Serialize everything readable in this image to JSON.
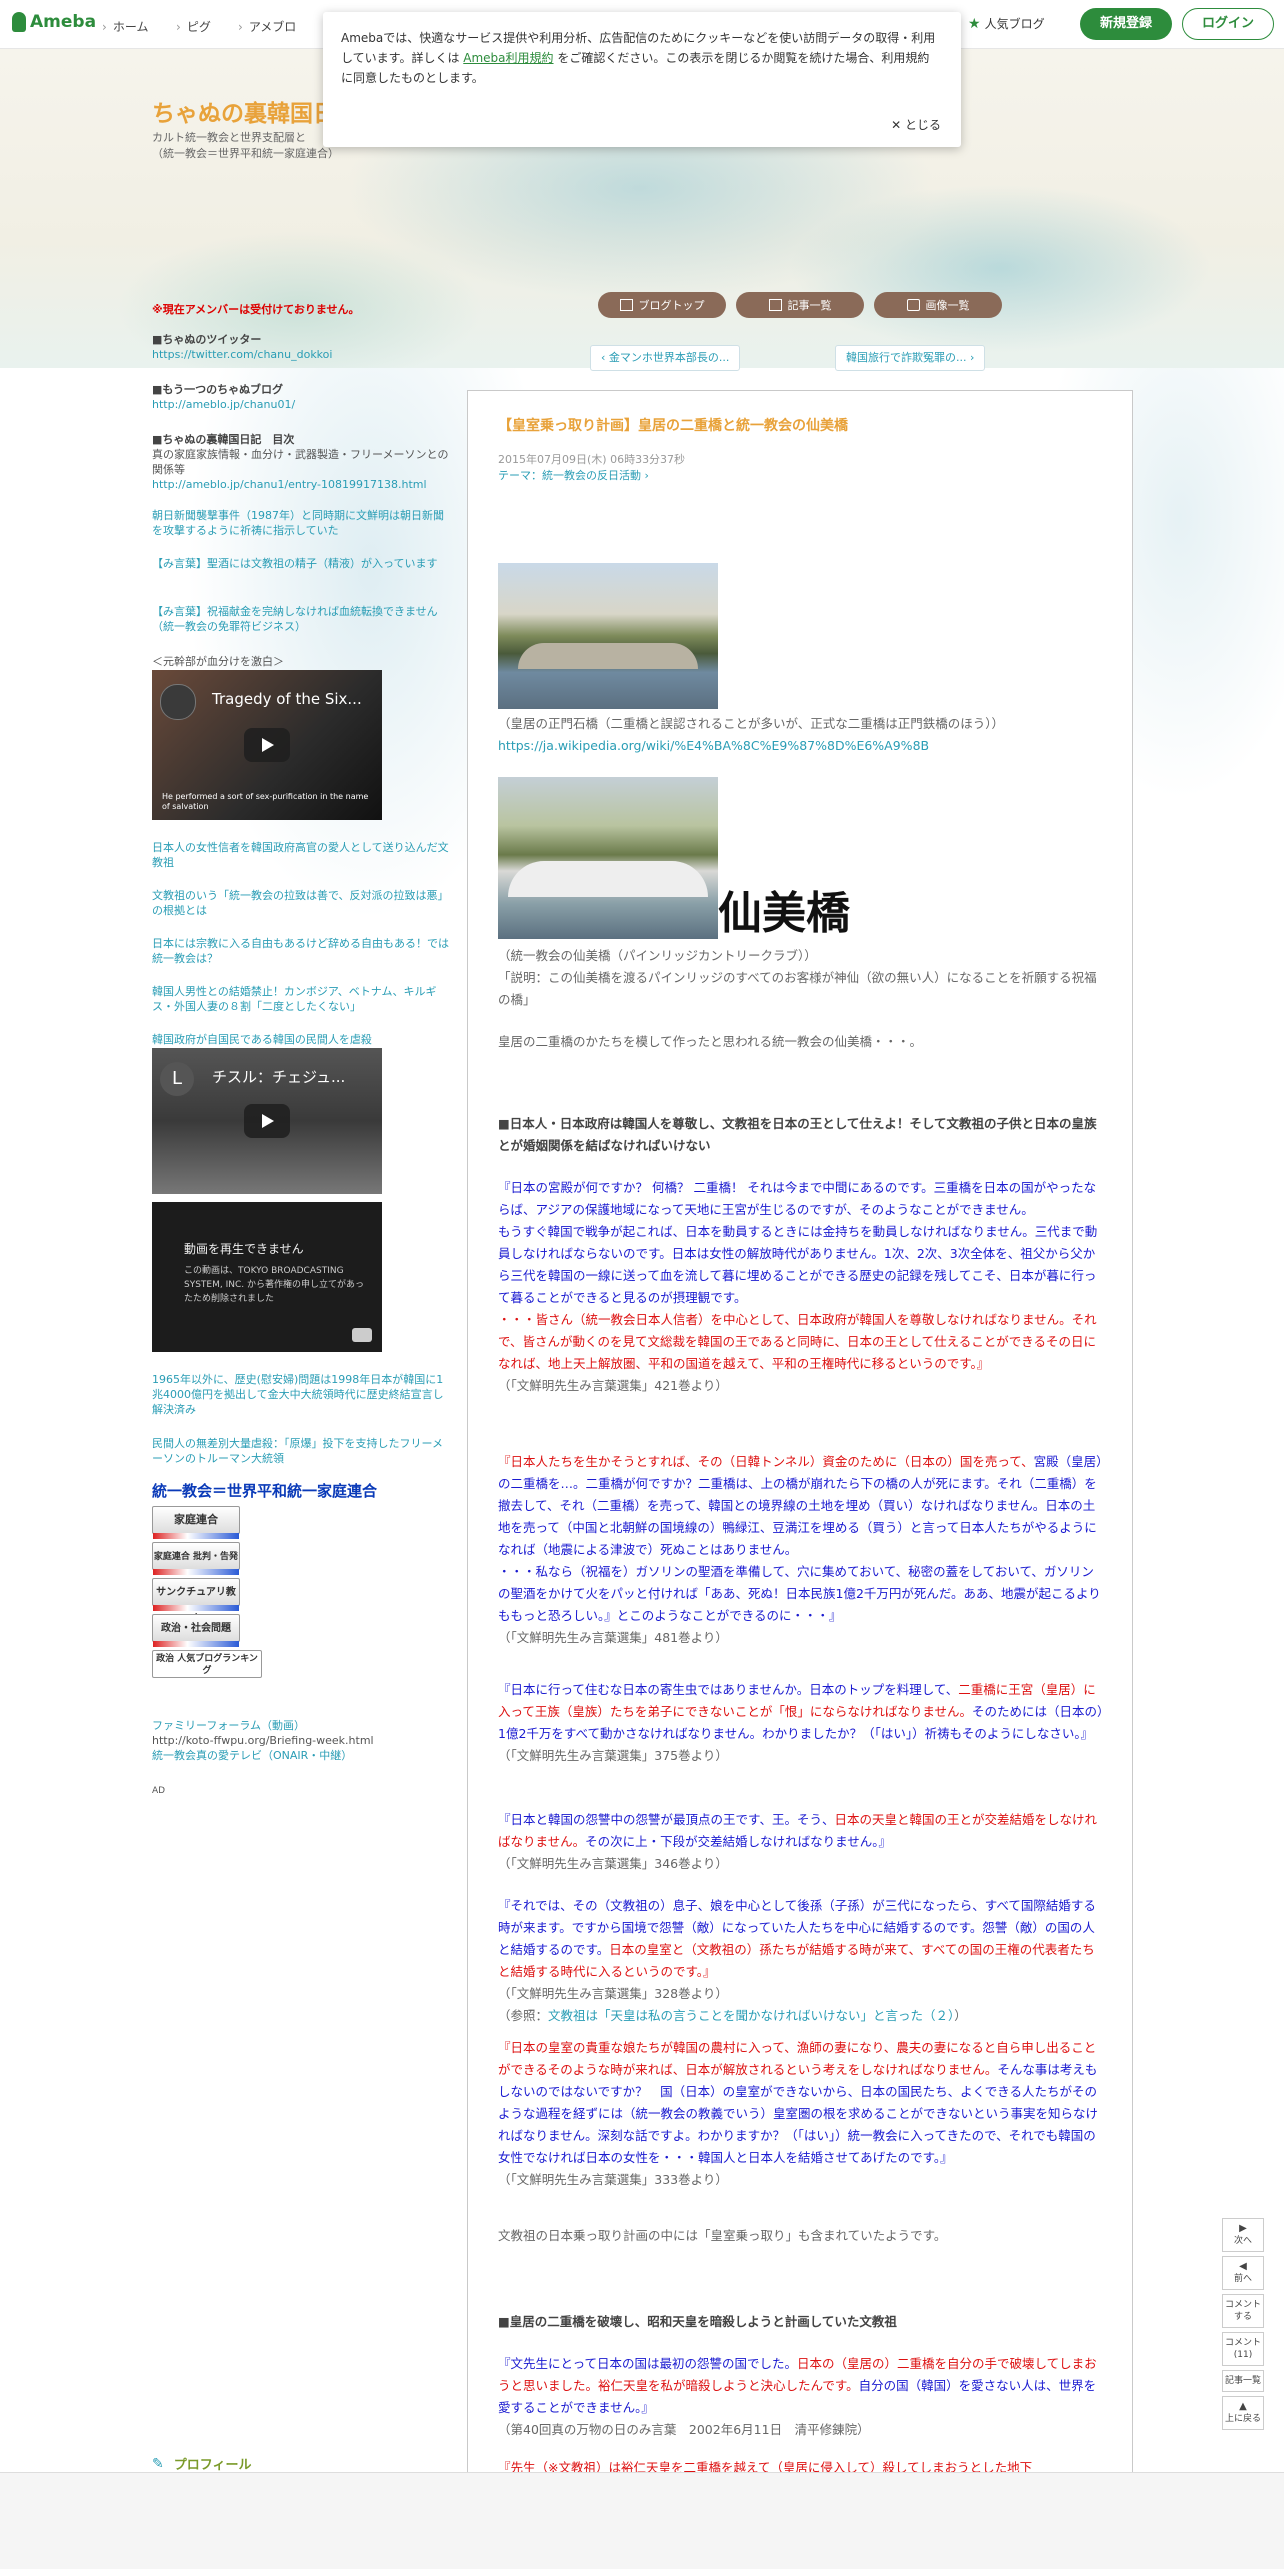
{
  "header": {
    "logo_text": "Ameba",
    "nav": [
      "ホーム",
      "ピグ",
      "アメブロ"
    ],
    "popular": "人気ブログ",
    "signup": "新規登録",
    "login": "ログイン"
  },
  "cookie": {
    "text_before": "Amebaでは、快適なサービス提供や利用分析、広告配信のためにクッキーなどを使い訪問データの取得・利用しています。詳しくは ",
    "link": "Ameba利用規約",
    "text_after": " をご確認ください。この表示を閉じるか閲覧を続けた場合、利用規約に同意したものとします。",
    "close": "とじる"
  },
  "blog": {
    "title": "ちゃぬの裏韓国日記",
    "desc1": "カルト統一教会と世界支配層と",
    "desc2": "（統一教会＝世界平和統一家庭連合）"
  },
  "tabs": [
    "ブログトップ",
    "記事一覧",
    "画像一覧"
  ],
  "pager": {
    "prev": "金マンホ世界本部長の...",
    "next": "韓国旅行で詐欺冤罪の..."
  },
  "sidebar": {
    "notice": "※現在アメンバーは受付けておりません。",
    "b1_h": "■ちゃぬのツイッター",
    "b1_link": "https://twitter.com/chanu_dokkoi",
    "b2_h": "■もう一つのちゃぬブログ",
    "b2_link": "http://ameblo.jp/chanu01/",
    "b3_h": "■ちゃぬの裏韓国日記　目次",
    "b3_t": "真の家庭家族情報・血分け・武器製造・フリーメーソンとの関係等",
    "b3_link": "http://ameblo.jp/chanu1/entry-10819917138.html",
    "l1": "朝日新聞襲撃事件（1987年）と同時期に文鮮明は朝日新聞を攻撃するように祈祷に指示していた",
    "l2": "【み言葉】聖酒には文教祖の精子（精液）が入っています",
    "l3": "【み言葉】祝福献金を完納しなければ血統転換できません（統一教会の免罪符ビジネス）",
    "t4": "＜元幹部が血分けを激白＞",
    "video1_title": "Tragedy of the Six...",
    "video1_cap": "He performed a sort of sex-purification in the name of salvation",
    "l5": "日本人の女性信者を韓国政府高官の愛人として送り込んだ文教祖",
    "l6": "文教祖のいう「統一教会の拉致は善で、反対派の拉致は悪」の根拠とは",
    "l7": "日本には宗教に入る自由もあるけど辞める自由もある！では統一教会は？",
    "l8": "韓国人男性との結婚禁止！カンボジア、ベトナム、キルギス・外国人妻の８割「二度としたくない」",
    "l9": "韓国政府が自国民である韓国の民間人を虐殺",
    "video2_title": "チスル：チェジュ...",
    "video2_avatar": "L",
    "video3_title": "動画を再生できません",
    "video3_text": "この動画は、TOKYO BROADCASTING SYSTEM, INC. から著作権の申し立てがあったため削除されました",
    "l10": "1965年以外に、歴史(慰安婦)問題は1998年日本が韓国に1兆4000億円を拠出して金大中大統領時代に歴史終結宣言し解決済み",
    "l11": "民間人の無差別大量虐殺：「原爆」投下を支持したフリーメーソンのトルーマン大統領",
    "ranking_h": "統一教会＝世界平和統一家庭連合",
    "r1": "家庭連合",
    "r2": "家庭連合 批判・告発",
    "r3": "サンクチュアリ教会",
    "r4": "政治・社会問題",
    "r5": "政治 人気ブログランキング",
    "l12": "ファミリーフォーラム（動画）",
    "t12": "http://koto-ffwpu.org/Briefing-week.html",
    "l13": "統一教会真の愛テレビ（ONAIR・中継）",
    "ad": "AD"
  },
  "article": {
    "title": "【皇室乗っ取り計画】皇居の二重橋と統一教会の仙美橋",
    "date": "2015年07月09日(木) 06時33分37秒",
    "theme_label": "テーマ：",
    "theme": "統一教会の反日活動",
    "cap1": "（皇居の正門石橋（二重橋と誤認されることが多いが、正式な二重橋は正門鉄橋のほう））",
    "cap1_link": "https://ja.wikipedia.org/wiki/%E4%BA%8C%E9%87%8D%E6%A9%8B",
    "calligraphy": "仙美橋",
    "cap2a": "（統一教会の仙美橋（パインリッジカントリークラブ））",
    "cap2b": "「説明：この仙美橋を渡るパインリッジのすべてのお客様が神仙（欲の無い人）になることを祈願する祝福の橋」",
    "p_intro": "皇居の二重橋のかたちを模して作ったと思われる統一教会の仙美橋・・・。",
    "h1": "■日本人・日本政府は韓国人を尊敬し、文教祖を日本の王として仕えよ！そして文教祖の子供と日本の皇族とが婚姻関係を結ばなければいけない",
    "q1_blue1": "『日本の宮殿が何ですか？ 何橋？ 二重橋！ それは今まで中間にあるのです。三重橋を日本の国がやったならば、アジアの保護地域になって天地に王宮が生じるのですが、そのようなことができません。",
    "q1_blue2": "もうすぐ韓国で戦争が起これば、日本を動員するときには金持ちを動員しなければなりません。三代まで動員しなければならないのです。日本は女性の解放時代がありません。1次、2次、3次全体を、祖父から父から三代を韓国の一線に送って血を流して暮に埋めることができる歴史の記録を残してこそ、日本が暮に行って暮ることができると見るのが摂理観です。",
    "q1_red": "・・・皆さん（統一教会日本人信者）を中心として、日本政府が韓国人を尊敬しなければなりません。それで、皆さんが動くのを見て文総裁を韓国の王であると同時に、日本の王として仕えることができるその日になれば、地上天上解放圏、平和の国道を越えて、平和の王権時代に移るというのです。』",
    "q1_src": "（「文鮮明先生み言葉選集」421巻より）",
    "q2_red1": "『日本人たちを生かそうとすれば、その（日韓トンネル）資金のために（日本の）国を売って、",
    "q2_blue": "宮殿（皇居）の二重橋を…。二重橋が何ですか？二重橋は、上の橋が崩れたら下の橋の人が死にます。それ（二重橋）を撤去して、それ（二重橋）を売って、韓国との境界線の土地を埋め（買い）なければなりません。日本の土地を売って（中国と北朝鮮の国境線の）鴨緑江、豆満江を埋める（買う）と言って日本人たちがやるようになれば（地震による津波で）死ぬことはありません。",
    "q2_blue2": "・・・私なら（祝福を）ガソリンの聖酒を準備して、穴に集めておいて、秘密の蓋をしておいて、ガソリンの聖酒をかけて火をパッと付ければ「ああ、死ぬ！日本民族1億2千万円が死んだ。ああ、地震が起こるよりももっと恐ろしい。』とこのようなことができるのに・・・』",
    "q2_src": "（「文鮮明先生み言葉選集」481巻より）",
    "q3_blue": "『日本に行って住むな日本の寄生虫ではありませんか。日本のトップを料理して、",
    "q3_red": "二重橋に王宮（皇居）に入って王族（皇族）たちを弟子にできないことが「恨」にならなければなりません。",
    "q3_blue2": "そのためには（日本の）1億2千万をすべて動かさなければなりません。わかりましたか？（「はい」）祈祷もそのようにしなさい。』",
    "q3_src": "（「文鮮明先生み言葉選集」375巻より）",
    "q4_blue": "『日本と韓国の怨讐中の怨讐が最頂点の王です、王。そう、",
    "q4_red": "日本の天皇と韓国の王とが交差結婚をしなければなりません。",
    "q4_blue2": "その次に上・下段が交差結婚しなければなりません。』",
    "q4_src": "（「文鮮明先生み言葉選集」346巻より）",
    "q5_blue": "『それでは、その（文教祖の）息子、娘を中心として後孫（子孫）が三代になったら、すべて国際結婚する時が来ます。ですから国境で怨讐（敵）になっていた人たちを中心に結婚するのです。怨讐（敵）の国の人と結婚するのです。",
    "q5_red": "日本の皇室と（文教祖の）孫たちが結婚する時が来て、すべての国の王権の代表者たちと結婚する時代に入るというのです。』",
    "q5_src": "（「文鮮明先生み言葉選集」328巻より）",
    "q5_ref_pre": "（参照：",
    "q5_ref_link": "文教祖は「天皇は私の言うことを聞かなければいけない」と言った（２）",
    "q5_ref_post": "）",
    "q6_red": "『日本の皇室の貴重な娘たちが韓国の農村に入って、漁師の妻になり、農夫の妻になると自ら申し出ることができるそのような時が来れば、日本が解放されるという考えをしなければなりません。",
    "q6_blue": "そんな事は考えもしないのではないですか？　国（日本）の皇室ができないから、日本の国民たち、よくできる人たちがそのような過程を経ずには（統一教会の教義でいう）皇室圏の根を求めることができないという事実を知らなければなりません。深刻な話ですよ。わかりますか？（「はい」）統一教会に入ってきたので、それでも韓国の女性でなければ日本の女性を・・・韓国人と日本人を結婚させてあげたのです。』",
    "q6_src": "（「文鮮明先生み言葉選集」333巻より）",
    "p_note": "文教祖の日本乗っ取り計画の中には「皇室乗っ取り」も含まれていたようです。",
    "h2": "■皇居の二重橋を破壊し、昭和天皇を暗殺しようと計画していた文教祖",
    "q7_blue": "『文先生にとって日本の国は最初の怨讐の国でした。",
    "q7_red": "日本の（皇居の）二重橋を自分の手で破壊してしまおうと思いました。裕仁天皇を私が暗殺しようと決心したんです。",
    "q7_blue2": "自分の国（韓国）を愛さない人は、世界を愛することができません。』",
    "q7_src": "（第40回真の万物の日のみ言葉　2002年6月11日　清平修錬院）",
    "q8_red": "『先生（※文教祖）は裕仁天皇を二重橋を越えて（皇居に侵入して）殺してしまおうとした地下"
  },
  "float": {
    "next": "次へ",
    "prev": "前へ",
    "comment": "コメントする",
    "comment_count": "コメント(11)",
    "list": "記事一覧",
    "top": "上に戻る"
  },
  "profile": "プロフィール"
}
